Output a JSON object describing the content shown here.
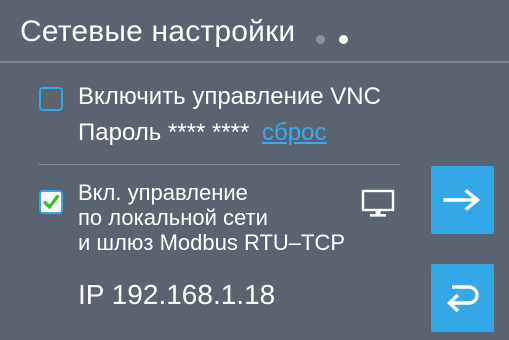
{
  "header": {
    "title": "Сетевые настройки",
    "page_count": 2,
    "current_page": 2
  },
  "vnc": {
    "label": "Включить управление VNC",
    "checked": false,
    "password_label": "Пароль",
    "password_value": "**** ****",
    "reset_link": "сброс"
  },
  "lan": {
    "lines": [
      "Вкл. управление",
      "по локальной сети",
      "и шлюз Modbus RTU–TCP"
    ],
    "checked": true,
    "icon": "monitor-icon"
  },
  "ip_line": "IP 192.168.1.18",
  "buttons": {
    "next_icon": "arrow-right-icon",
    "back_icon": "return-icon"
  },
  "colors": {
    "background": "#596470",
    "accent": "#34a7e6",
    "check_green": "#3fbf2f",
    "link": "#3aa9ee"
  }
}
